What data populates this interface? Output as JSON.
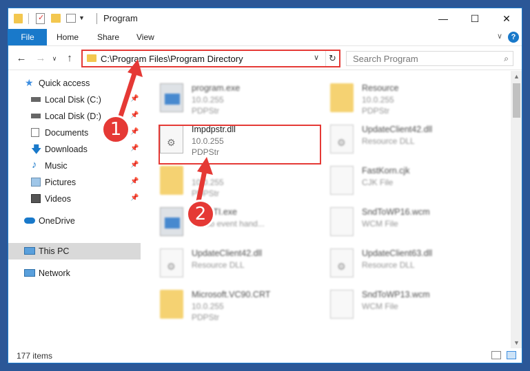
{
  "window": {
    "title": "Program"
  },
  "ribbon": {
    "tabs": [
      "File",
      "Home",
      "Share",
      "View"
    ],
    "help": "?"
  },
  "nav": {
    "address": "C:\\Program Files\\Program Directory",
    "search_placeholder": "Search Program"
  },
  "sidebar": {
    "items": [
      {
        "label": "Quick access",
        "icon": "star-icon"
      },
      {
        "label": "Local Disk (C:)",
        "icon": "disk-icon",
        "pinned": true
      },
      {
        "label": "Local Disk (D:)",
        "icon": "disk-icon",
        "pinned": true
      },
      {
        "label": "Documents",
        "icon": "documents-icon",
        "pinned": true
      },
      {
        "label": "Downloads",
        "icon": "download-icon",
        "pinned": true
      },
      {
        "label": "Music",
        "icon": "music-icon",
        "pinned": true
      },
      {
        "label": "Pictures",
        "icon": "pictures-icon",
        "pinned": true
      },
      {
        "label": "Videos",
        "icon": "videos-icon",
        "pinned": true
      },
      {
        "label": "OneDrive",
        "icon": "cloud-icon"
      },
      {
        "label": "This PC",
        "icon": "pc-icon",
        "selected": true
      },
      {
        "label": "Network",
        "icon": "network-icon"
      }
    ]
  },
  "files": [
    {
      "name": "program.exe",
      "line2": "10.0.255",
      "line3": "PDPStr",
      "icon": "exe-icon"
    },
    {
      "name": "Resource",
      "line2": "10.0.255",
      "line3": "PDPStr",
      "icon": "folder-icon"
    },
    {
      "name": "Impdpstr.dll",
      "line2": "10.0.255",
      "line3": "PDPStr",
      "icon": "dll-icon",
      "highlighted": true
    },
    {
      "name": "UpdateClient42.dll",
      "line2": "Resource DLL",
      "line3": "",
      "icon": "dll-icon"
    },
    {
      "name": "",
      "line2": "10.0.255",
      "line3": "PDPStr",
      "icon": "folder-icon"
    },
    {
      "name": "FastKorn.cjk",
      "line2": "CJK File",
      "line3": "",
      "icon": "file-icon"
    },
    {
      "name": "...yySTI.exe",
      "line2": "...T sb event hand...",
      "line3": "",
      "icon": "exe-icon"
    },
    {
      "name": "SndToWP16.wcm",
      "line2": "WCM File",
      "line3": "",
      "icon": "file-icon"
    },
    {
      "name": "UpdateClient42.dll",
      "line2": "Resource DLL",
      "line3": "",
      "icon": "dll-icon"
    },
    {
      "name": "UpdateClient63.dll",
      "line2": "Resource DLL",
      "line3": "",
      "icon": "dll-icon"
    },
    {
      "name": "Microsoft.VC90.CRT",
      "line2": "10.0.255",
      "line3": "PDPStr",
      "icon": "folder-icon"
    },
    {
      "name": "SndToWP13.wcm",
      "line2": "WCM File",
      "line3": "",
      "icon": "file-icon"
    }
  ],
  "status": {
    "count": "177 items"
  },
  "callouts": [
    "1",
    "2"
  ],
  "colors": {
    "accent": "#1979ca",
    "annotation": "#e53935",
    "folder": "#f3c74f"
  }
}
